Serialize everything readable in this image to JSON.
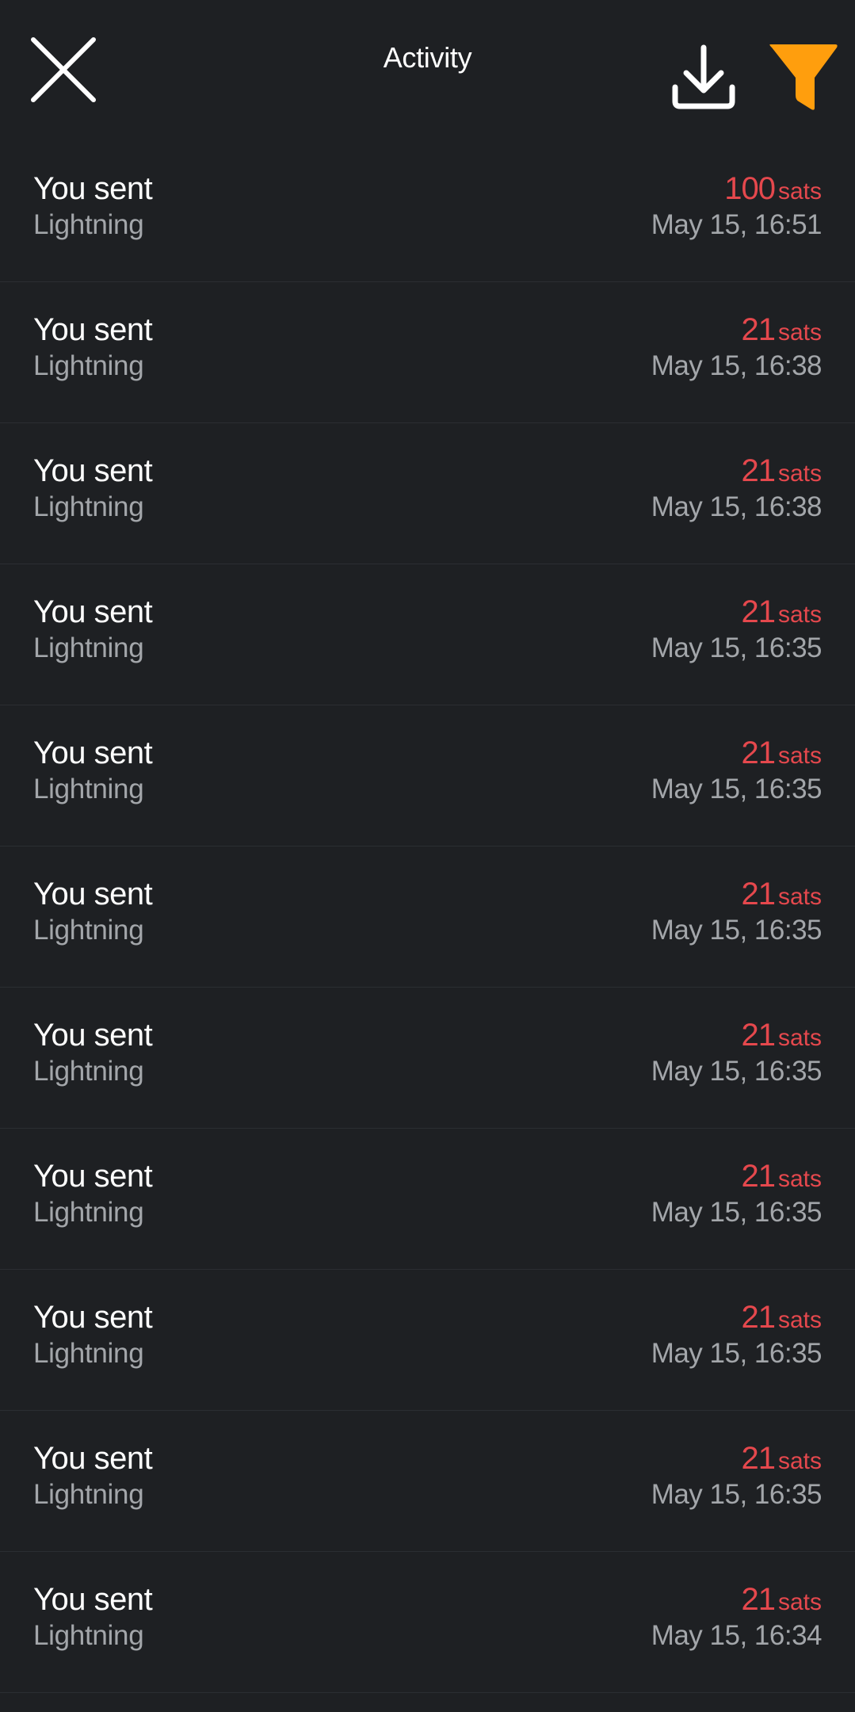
{
  "header": {
    "title": "Activity",
    "close_icon": "close-icon",
    "download_icon": "download-icon",
    "filter_icon": "filter-icon",
    "filter_color": "#ff9e0d"
  },
  "colors": {
    "background": "#1e2023",
    "sent_amount": "#e5484d",
    "secondary_text": "#a3a6aa"
  },
  "transactions": [
    {
      "title": "You sent",
      "method": "Lightning",
      "amount": "100",
      "unit": "sats",
      "date": "May 15, 16:51"
    },
    {
      "title": "You sent",
      "method": "Lightning",
      "amount": "21",
      "unit": "sats",
      "date": "May 15, 16:38"
    },
    {
      "title": "You sent",
      "method": "Lightning",
      "amount": "21",
      "unit": "sats",
      "date": "May 15, 16:38"
    },
    {
      "title": "You sent",
      "method": "Lightning",
      "amount": "21",
      "unit": "sats",
      "date": "May 15, 16:35"
    },
    {
      "title": "You sent",
      "method": "Lightning",
      "amount": "21",
      "unit": "sats",
      "date": "May 15, 16:35"
    },
    {
      "title": "You sent",
      "method": "Lightning",
      "amount": "21",
      "unit": "sats",
      "date": "May 15, 16:35"
    },
    {
      "title": "You sent",
      "method": "Lightning",
      "amount": "21",
      "unit": "sats",
      "date": "May 15, 16:35"
    },
    {
      "title": "You sent",
      "method": "Lightning",
      "amount": "21",
      "unit": "sats",
      "date": "May 15, 16:35"
    },
    {
      "title": "You sent",
      "method": "Lightning",
      "amount": "21",
      "unit": "sats",
      "date": "May 15, 16:35"
    },
    {
      "title": "You sent",
      "method": "Lightning",
      "amount": "21",
      "unit": "sats",
      "date": "May 15, 16:35"
    },
    {
      "title": "You sent",
      "method": "Lightning",
      "amount": "21",
      "unit": "sats",
      "date": "May 15, 16:34"
    }
  ]
}
